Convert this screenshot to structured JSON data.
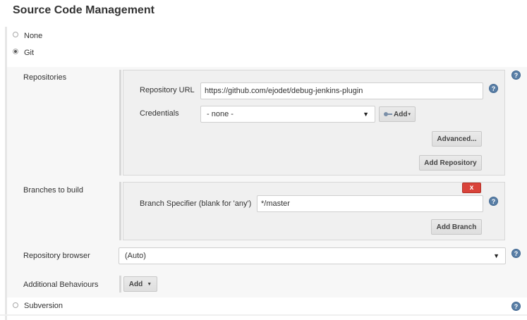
{
  "section": {
    "title": "Source Code Management"
  },
  "scm_options": {
    "none": "None",
    "git": "Git",
    "subversion": "Subversion",
    "selected": "Git"
  },
  "git": {
    "repositories": {
      "label": "Repositories",
      "url_label": "Repository URL",
      "url_value": "https://github.com/ejodet/debug-jenkins-plugin",
      "credentials_label": "Credentials",
      "credentials_value": "- none -",
      "add_credentials_label": "Add",
      "advanced_label": "Advanced...",
      "add_repository_label": "Add Repository"
    },
    "branches": {
      "label": "Branches to build",
      "delete_label": "x",
      "specifier_label": "Branch Specifier (blank for 'any')",
      "specifier_value": "*/master",
      "add_branch_label": "Add Branch"
    },
    "repository_browser": {
      "label": "Repository browser",
      "value": "(Auto)"
    },
    "additional_behaviours": {
      "label": "Additional Behaviours",
      "add_label": "Add"
    }
  },
  "help_icon_text": "?",
  "colors": {
    "help_icon": "#5a7fa6",
    "delete_button": "#d9433a",
    "panel_background": "#f7f7f7",
    "subpanel_background": "#f0f0f0"
  },
  "icons": {
    "help": "question-circle-icon",
    "credentials_add": "key-icon",
    "dropdown": "caret-down-icon"
  }
}
